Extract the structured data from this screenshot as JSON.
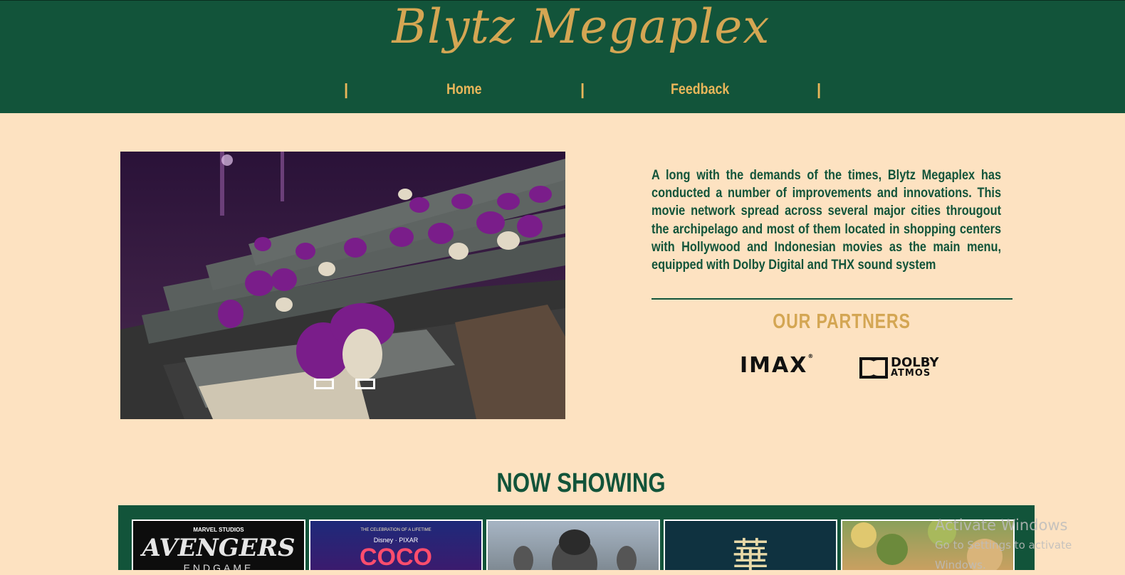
{
  "site": {
    "logo": "Blytz Megaplex"
  },
  "nav": {
    "separator": "|",
    "items": [
      {
        "label": "Home"
      },
      {
        "label": "Feedback"
      }
    ]
  },
  "about": {
    "text": "A long with the demands of the times, Blytz Megaplex has conducted a number of improvements and innovations. This movie network spread across several major cities througout the archipelago and most of them located in shopping centers with Hollywood and Indonesian movies as the main menu, equipped with Dolby Digital and THX sound system"
  },
  "partners": {
    "title": "OUR PARTNERS",
    "imax": "IMAX",
    "dolby_line1": "DOLBY",
    "dolby_line2": "ATMOS"
  },
  "now_showing": {
    "title": "NOW SHOWING",
    "posters": [
      {
        "brand": "MARVEL STUDIOS",
        "title": "AVENGERS",
        "subtitle": "ENDGAME"
      },
      {
        "brand": "THE CELEBRATION OF A LIFETIME",
        "studio": "Disney · PIXAR",
        "title": "COCO"
      },
      {
        "title": ""
      },
      {
        "title": "華"
      },
      {
        "title": ""
      }
    ]
  },
  "slider": {
    "active_index": 0,
    "dot_count": 2
  },
  "watermark": {
    "line1": "Activate Windows",
    "line2": "Go to Settings to activate Windows."
  },
  "colors": {
    "background": "#fde2c1",
    "header": "#12543a",
    "accent": "#d4a653",
    "nav_text": "#e8b65a",
    "seat_purple": "#7a1d8a"
  }
}
